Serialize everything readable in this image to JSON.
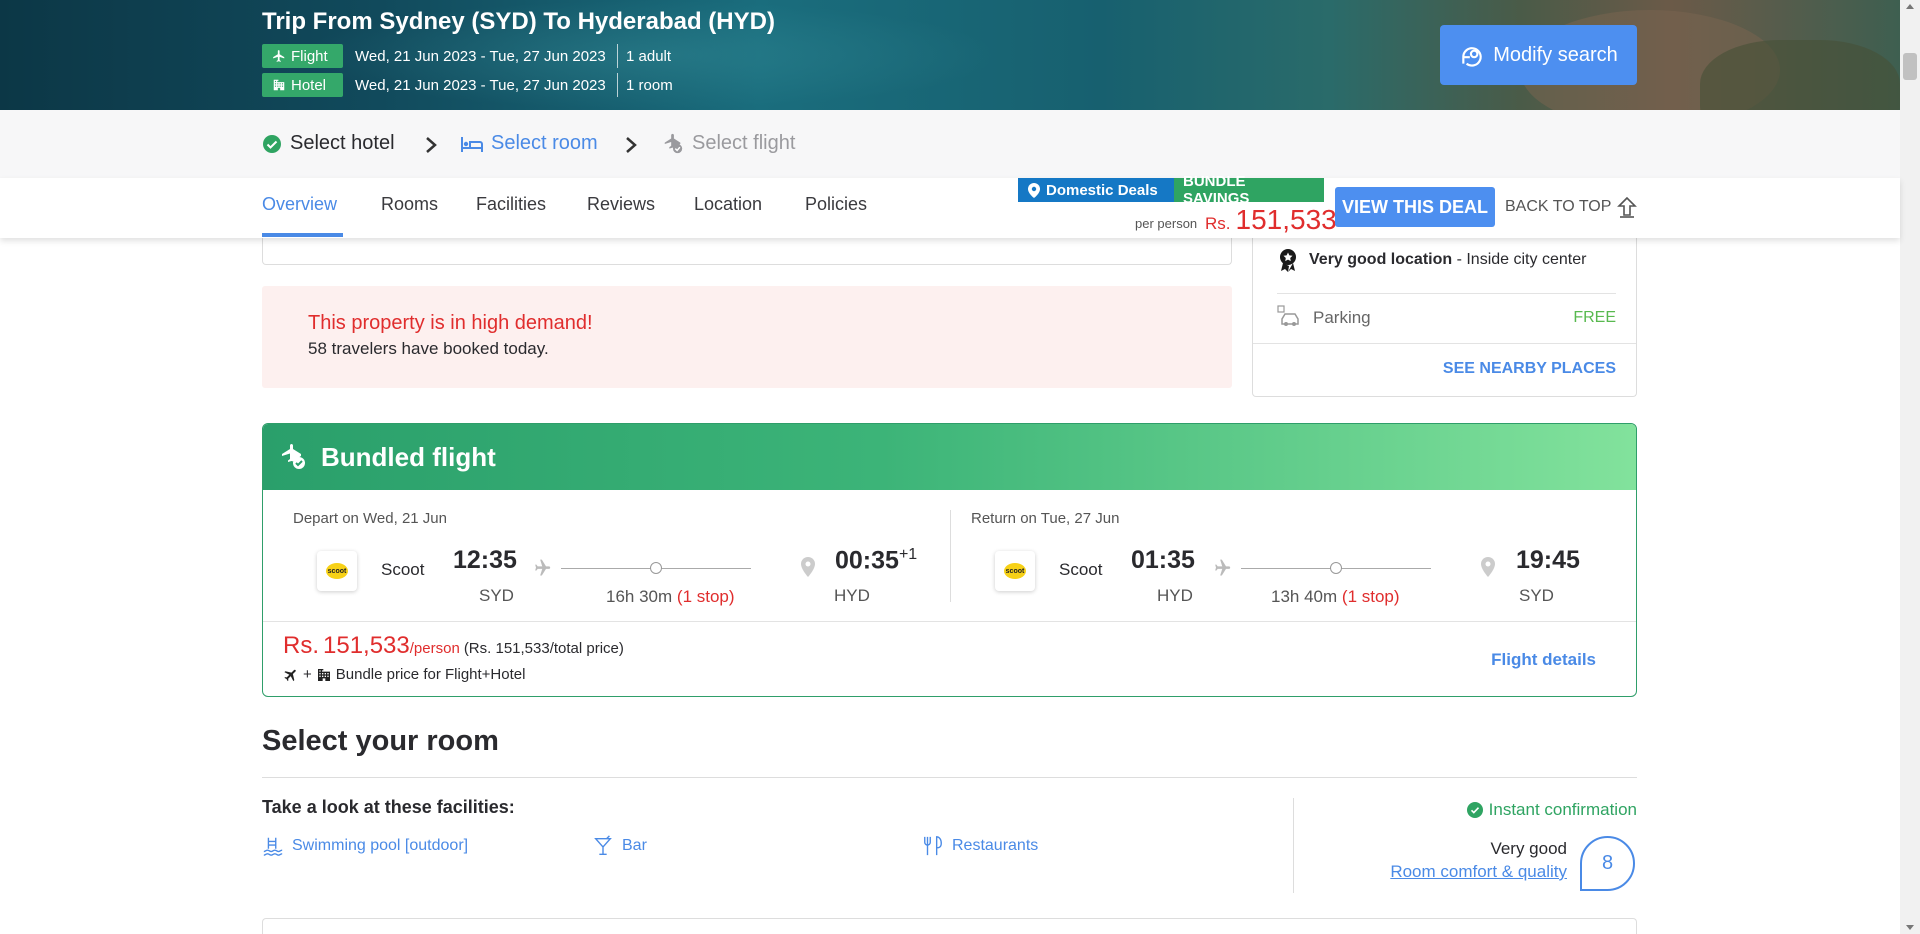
{
  "header": {
    "title": "Trip From Sydney (SYD) To Hyderabad (HYD)",
    "flight_tag": "Flight",
    "flight_dates": "Wed, 21 Jun 2023 - Tue, 27 Jun 2023",
    "flight_pax": "1 adult",
    "hotel_tag": "Hotel",
    "hotel_dates": "Wed, 21 Jun 2023 - Tue, 27 Jun 2023",
    "hotel_rooms": "1 room",
    "modify_label": "Modify search",
    "tag_color": "#34a86a",
    "button_color": "#4d8ff0"
  },
  "steps": [
    {
      "label": "Select hotel",
      "state": "done",
      "icon": "check-circle-icon"
    },
    {
      "label": "Select room",
      "state": "active",
      "icon": "bed-icon"
    },
    {
      "label": "Select flight",
      "state": "pending",
      "icon": "plane-check-icon"
    }
  ],
  "nav": {
    "tabs": [
      "Overview",
      "Rooms",
      "Facilities",
      "Reviews",
      "Location",
      "Policies"
    ],
    "active_tab": "Overview",
    "deal_badge": "Domestic Deals",
    "bundle_badge": "BUNDLE SAVINGS",
    "per_person": "per person",
    "currency": "Rs.",
    "price": "151,533",
    "view_deal": "VIEW THIS DEAL",
    "back_to_top": "BACK TO TOP"
  },
  "location_card": {
    "location_strong": "Very good location",
    "location_rest": " - Inside city center",
    "parking_label": "Parking",
    "parking_value": "FREE",
    "nearby_link": "SEE NEARBY PLACES"
  },
  "demand": {
    "headline": "This property is in high demand!",
    "count": "58",
    "rest": " travelers have booked today."
  },
  "bundle": {
    "title": "Bundled flight",
    "legs": [
      {
        "head": "Depart on Wed, 21 Jun",
        "airline": "Scoot",
        "logo_text": "scoot",
        "dep_time": "12:35",
        "dep_code": "SYD",
        "duration": "16h 30m",
        "stops": "(1 stop)",
        "arr_time": "00:35",
        "arr_plus": "+1",
        "arr_code": "HYD"
      },
      {
        "head": "Return on Tue, 27 Jun",
        "airline": "Scoot",
        "logo_text": "scoot",
        "dep_time": "01:35",
        "dep_code": "HYD",
        "duration": "13h 40m",
        "stops": "(1 stop)",
        "arr_time": "19:45",
        "arr_plus": "",
        "arr_code": "SYD"
      }
    ],
    "price_currency": "Rs.",
    "price_amount": "151,533",
    "price_per": "/person",
    "price_total": "(Rs. 151,533/total price)",
    "note_plus": "+",
    "note": "Bundle price for Flight+Hotel",
    "details_link": "Flight details"
  },
  "rooms": {
    "title": "Select your room",
    "facilities_title": "Take a look at these facilities:",
    "facilities": [
      {
        "label": "Swimming pool [outdoor]",
        "icon": "pool-icon"
      },
      {
        "label": "Bar",
        "icon": "cocktail-icon"
      },
      {
        "label": "Restaurants",
        "icon": "fork-knife-icon"
      }
    ],
    "instant": "Instant confirmation",
    "rating_word": "Very good",
    "rating_link": "Room comfort & quality",
    "rating_score": "8"
  },
  "colors": {
    "accent_blue": "#4a8ae6",
    "price_red": "#e02d2d",
    "green": "#2fa462"
  }
}
